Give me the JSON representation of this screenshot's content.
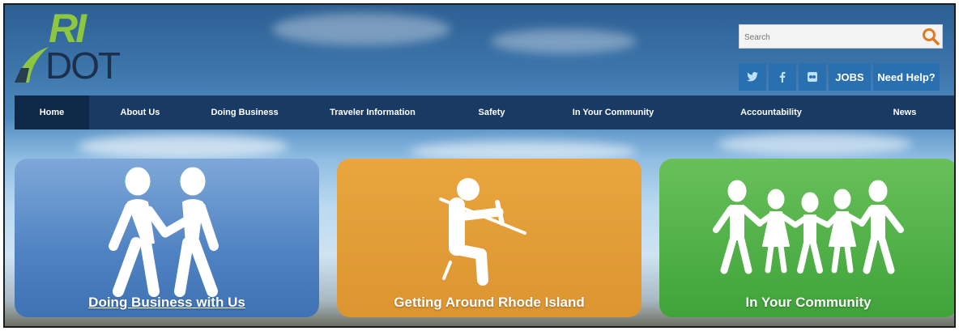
{
  "logo": {
    "ri_text": "RI",
    "dot_text": "DOT"
  },
  "search": {
    "placeholder": "Search",
    "icon": "search-icon"
  },
  "social": {
    "twitter": "twitter-icon",
    "facebook": "facebook-icon",
    "flickr": "flickr-icon"
  },
  "util_buttons": {
    "jobs": "JOBS",
    "help": "Need Help?"
  },
  "nav": {
    "items": [
      {
        "label": "Home"
      },
      {
        "label": "About Us"
      },
      {
        "label": "Doing Business"
      },
      {
        "label": "Traveler Information"
      },
      {
        "label": "Safety"
      },
      {
        "label": "In Your Community"
      },
      {
        "label": "Accountability"
      },
      {
        "label": "News"
      }
    ]
  },
  "cards": [
    {
      "label": "Doing Business with Us",
      "icon": "handshake-people-icon",
      "color": "#4f82c2"
    },
    {
      "label": "Getting Around Rhode Island",
      "icon": "driver-seatbelt-icon",
      "color": "#dc9530"
    },
    {
      "label": "In Your Community",
      "icon": "people-chain-icon",
      "color": "#3fa33a"
    }
  ],
  "colors": {
    "nav_bg": "#183a63",
    "logo_green": "#8dc63f",
    "search_icon": "#e07a1f"
  }
}
